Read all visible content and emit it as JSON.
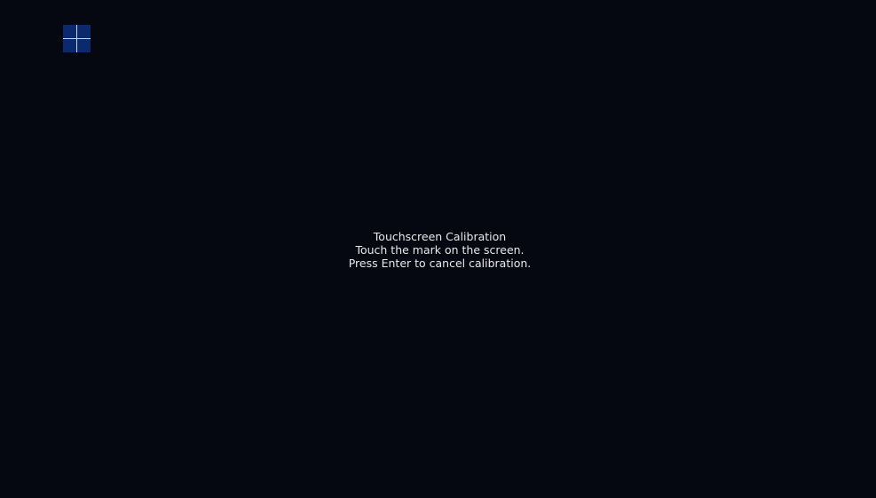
{
  "calibration": {
    "title": "Touchscreen Calibration",
    "instruction": "Touch the mark on the screen.",
    "cancel_hint": "Press Enter to cancel calibration."
  },
  "target": {
    "icon": "crosshair-icon"
  },
  "colors": {
    "background": "#060811",
    "target_fill": "#0b2a6e",
    "target_cross": "#c8d2ea",
    "text": "#e8e8ee"
  }
}
